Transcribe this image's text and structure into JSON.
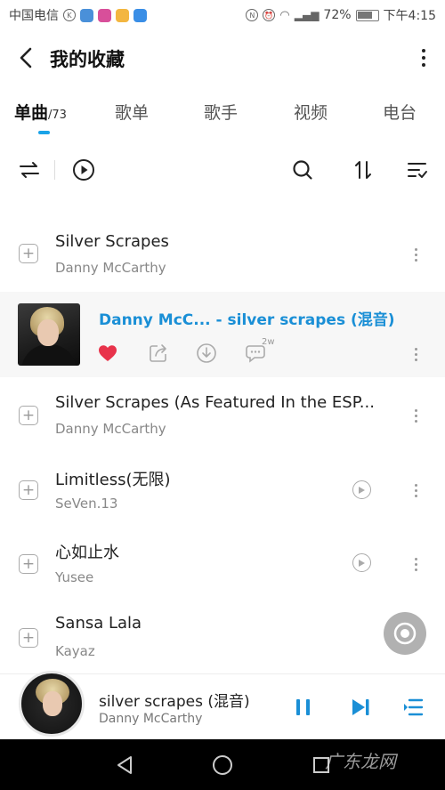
{
  "status_bar": {
    "carrier": "中国电信",
    "battery": "72%",
    "time": "下午4:15"
  },
  "header": {
    "title": "我的收藏"
  },
  "tabs": [
    {
      "label": "单曲",
      "count": "/73",
      "active": true
    },
    {
      "label": "歌单"
    },
    {
      "label": "歌手"
    },
    {
      "label": "视频"
    },
    {
      "label": "电台"
    }
  ],
  "songs": [
    {
      "title": "Silver Scrapes",
      "artist": "Danny McCarthy"
    },
    {
      "title": "Danny McC... - silver scrapes (混音)",
      "playing": true,
      "comments": "2w"
    },
    {
      "title": "Silver Scrapes (As Featured In the ESP...",
      "artist": "Danny McCarthy"
    },
    {
      "title": "Limitless(无限)",
      "artist": "SeVen.13",
      "has_mv": true
    },
    {
      "title": "心如止水",
      "artist": "Yusee",
      "has_mv": true
    },
    {
      "title": "Sansa Lala",
      "artist": "Kayaz"
    }
  ],
  "mini_player": {
    "title": "silver scrapes (混音)",
    "artist": "Danny McCarthy"
  },
  "watermark": "广东龙网",
  "colors": {
    "accent": "#1a8fd6",
    "heart": "#e8334b",
    "indicator": "#1aa3e8"
  }
}
